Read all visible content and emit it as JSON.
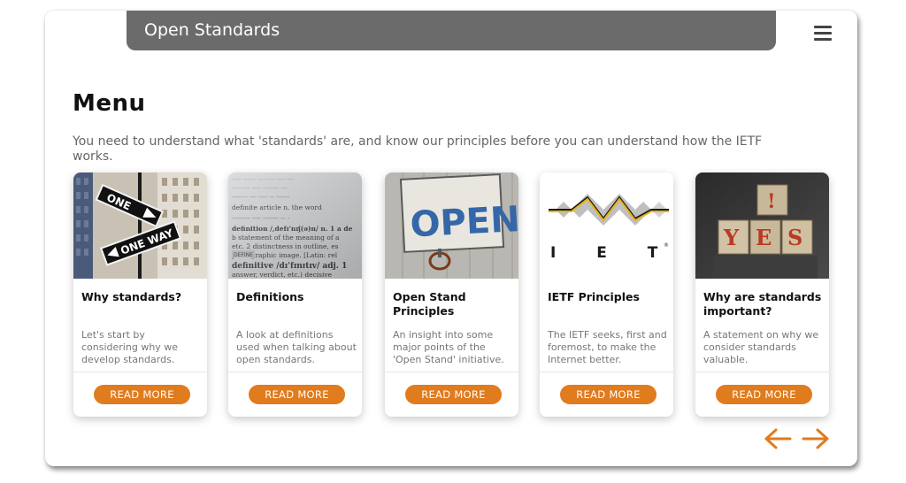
{
  "header": {
    "title": "Open Standards",
    "menu_icon": "hamburger-menu-icon"
  },
  "main": {
    "heading": "Menu",
    "intro": "You need to understand what 'standards' are, and know our principles before you can understand how the IETF works."
  },
  "cards": [
    {
      "image": "one-way-street-sign",
      "title": "Why standards?",
      "description": "Let's start by considering why we develop standards.",
      "button": "READ MORE"
    },
    {
      "image": "dictionary-definition",
      "title": "Definitions",
      "description": "A look at definitions used when talking about open standards.",
      "button": "READ MORE"
    },
    {
      "image": "open-sign",
      "title": "Open Stand Principles",
      "description": "An insight into some major points of the 'Open Stand' initiative.",
      "button": "READ MORE"
    },
    {
      "image": "ietf-logo",
      "title": "IETF Principles",
      "description": "The IETF seeks, first and foremost, to make the Internet better.",
      "button": "READ MORE",
      "logo_text": "I E T F",
      "logo_mark": "®"
    },
    {
      "image": "yes-blocks",
      "title": "Why are standards important?",
      "description": "A statement on why we consider standards valuable.",
      "button": "READ MORE"
    }
  ],
  "images": {
    "card1": {
      "sign1": "ONE",
      "sign2": "ONE WAY"
    },
    "card2": {
      "lines": [
        "definite article  n. the word",
        "definition /,defɪ'nɪʃ(ə)n/ n. 1 a de",
        "b statement of the meaning of a",
        "etc. 2 distinctness in outline, es",
        "photographic image. [Latin: rel",
        "definitive  /dɪ'fɪnɪtɪv/  adj. 1",
        "answer, verdict, etc.) decisive"
      ],
      "tag1": "DEFINE",
      "tag2": "DEFINE"
    },
    "card3": {
      "sign": "OPEN"
    },
    "card5": {
      "blocks": [
        "Y",
        "E",
        "S",
        "!"
      ]
    }
  },
  "nav": {
    "prev_icon": "arrow-left-icon",
    "next_icon": "arrow-right-icon"
  },
  "colors": {
    "accent": "#e07b1e",
    "title_bar": "#6b6b6b"
  }
}
